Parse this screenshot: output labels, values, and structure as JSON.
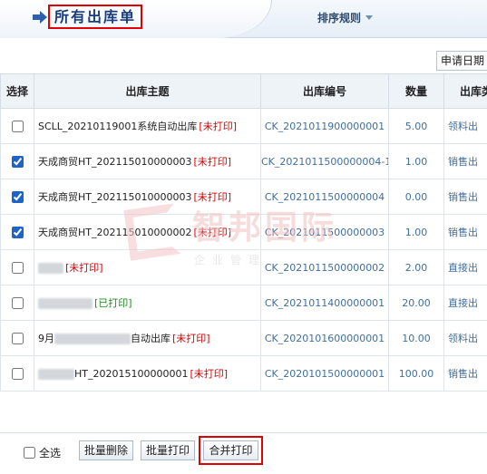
{
  "header": {
    "title": "所有出库单",
    "sort_rule_label": "排序规则"
  },
  "toolbar": {
    "sort_field": "申请日期"
  },
  "table": {
    "columns": [
      "选择",
      "出库主题",
      "出库编号",
      "数量",
      "出库类"
    ],
    "rows": [
      {
        "checked": false,
        "subject": "SCLL_20210119001系统自动出库",
        "status": "[未打印]",
        "printed": false,
        "code": "CK_2021011900000001",
        "qty": "5.00",
        "type": "领料出"
      },
      {
        "checked": true,
        "subject": "天成商贸HT_202115010000003",
        "status": "[未打印]",
        "printed": false,
        "code": "CK_2021011500000004-1",
        "qty": "1.00",
        "type": "销售出"
      },
      {
        "checked": true,
        "subject": "天成商贸HT_202115010000003",
        "status": "[未打印]",
        "printed": false,
        "code": "CK_2021011500000004",
        "qty": "0.00",
        "type": "销售出"
      },
      {
        "checked": true,
        "subject": "天成商贸HT_202115010000002",
        "status": "[未打印]",
        "printed": false,
        "code": "CK_2021011500000003",
        "qty": "1.00",
        "type": "销售出"
      },
      {
        "checked": false,
        "subject": "",
        "status": "[未打印]",
        "printed": false,
        "code": "CK_2021011500000002",
        "qty": "2.00",
        "type": "直接出"
      },
      {
        "checked": false,
        "subject": "",
        "status": "[已打印]",
        "printed": true,
        "code": "CK_2021011400000001",
        "qty": "20.00",
        "type": "直接出"
      },
      {
        "checked": false,
        "subject": "9月",
        "subject_suffix": "自动出库",
        "status": "[未打印]",
        "printed": false,
        "code": "CK_2020101600000001",
        "qty": "10.00",
        "type": "领料出"
      },
      {
        "checked": false,
        "subject": "HT_202015100000001",
        "status": "[未打印]",
        "printed": false,
        "code": "CK_2020101500000001",
        "qty": "100.00",
        "type": "销售出"
      }
    ]
  },
  "watermark": {
    "text": "智邦国际",
    "sub": "企业管理"
  },
  "footer": {
    "select_all_label": "全选",
    "batch_delete_label": "批量删除",
    "batch_print_label": "批量打印",
    "merge_print_label": "合并打印"
  },
  "colors": {
    "highlight_frame": "#e00000",
    "title_blue": "#1a3d7c",
    "unprinted_red": "#d40000",
    "printed_green": "#1f8c1f"
  }
}
